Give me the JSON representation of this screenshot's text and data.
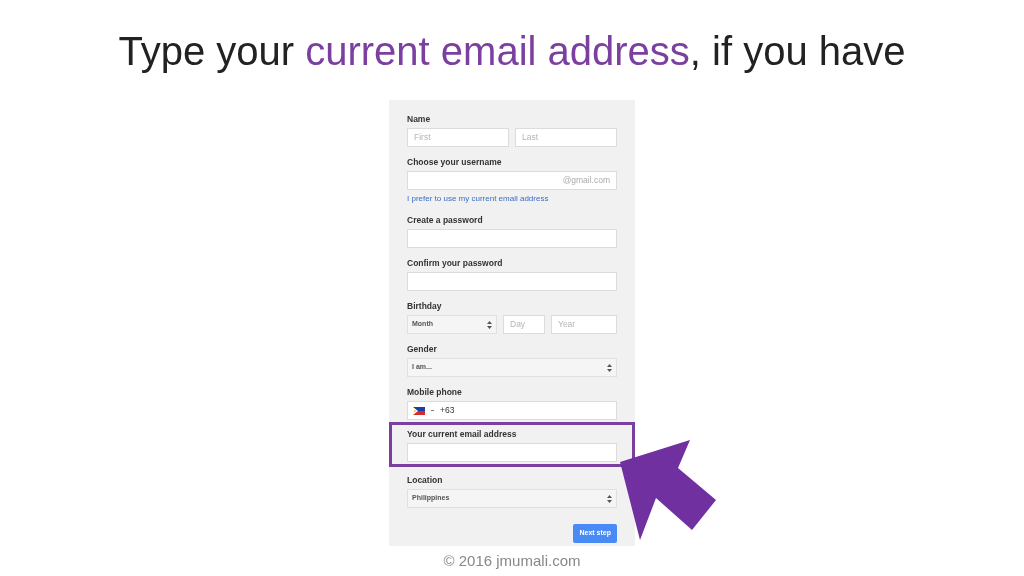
{
  "title": [
    {
      "text": "Type your ",
      "highlighted": false
    },
    {
      "text": "current email address",
      "highlighted": true
    },
    {
      "text": ", if you have",
      "highlighted": false
    }
  ],
  "form": {
    "sections": [
      {
        "label": "Name",
        "highlighted": false,
        "controls": [
          {
            "kind": "input",
            "placeholder": "First"
          },
          {
            "kind": "input",
            "placeholder": "Last"
          }
        ]
      },
      {
        "label": "Choose your username",
        "highlighted": false,
        "controls": [
          {
            "kind": "input",
            "suffix": "@gmail.com"
          },
          {
            "kind": "link",
            "text": "I prefer to use my current email address"
          }
        ]
      },
      {
        "label": "Create a password",
        "highlighted": false,
        "controls": [
          {
            "kind": "input"
          }
        ]
      },
      {
        "label": "Confirm your password",
        "highlighted": false,
        "controls": [
          {
            "kind": "input"
          }
        ]
      },
      {
        "label": "Birthday",
        "highlighted": false,
        "controls": [
          {
            "kind": "select",
            "value": "Month"
          },
          {
            "kind": "input",
            "placeholder": "Day"
          },
          {
            "kind": "input",
            "placeholder": "Year"
          }
        ]
      },
      {
        "label": "Gender",
        "highlighted": false,
        "controls": [
          {
            "kind": "select",
            "value": "I am..."
          }
        ]
      },
      {
        "label": "Mobile phone",
        "highlighted": false,
        "controls": [
          {
            "kind": "phone",
            "value": "+63"
          }
        ]
      },
      {
        "label": "Your current email address",
        "highlighted": true,
        "controls": [
          {
            "kind": "input"
          }
        ]
      },
      {
        "label": "Location",
        "highlighted": false,
        "controls": [
          {
            "kind": "select",
            "value": "Philippines"
          }
        ]
      }
    ],
    "button": "Next step"
  },
  "footer": "© 2016 jmumali.com"
}
